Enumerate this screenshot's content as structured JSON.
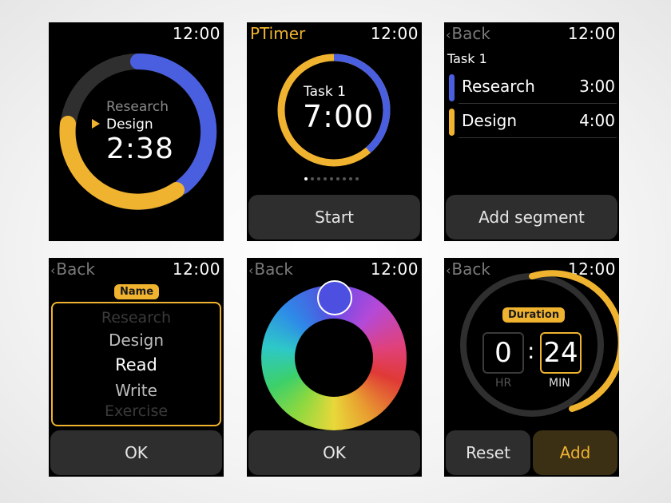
{
  "status_time": "12:00",
  "back_label": "Back",
  "colors": {
    "accent_yellow": "#f0b330",
    "accent_blue": "#4a5fe0",
    "button_bg": "#2e2e2e",
    "track_gray": "#2f2f2f"
  },
  "screen1": {
    "previous_segment": "Research",
    "current_segment": "Design",
    "remaining_time": "2:38",
    "ring_progress_fraction": 0.38
  },
  "screen2": {
    "app_title": "PTimer",
    "task_name": "Task 1",
    "total_time": "7:00",
    "page_count": 9,
    "active_page": 0,
    "start_label": "Start"
  },
  "screen3": {
    "task_name": "Task 1",
    "segments": [
      {
        "name": "Research",
        "duration": "3:00",
        "color": "#4a5fe0"
      },
      {
        "name": "Design",
        "duration": "4:00",
        "color": "#f0b330"
      }
    ],
    "add_segment_label": "Add segment"
  },
  "screen4": {
    "field_label": "Name",
    "options": [
      "Research",
      "Design",
      "Read",
      "Write",
      "Exercise"
    ],
    "selected": "Read",
    "ok_label": "OK"
  },
  "screen5": {
    "selected_color": "#4d4fe0",
    "ok_label": "OK"
  },
  "screen6": {
    "field_label": "Duration",
    "hours": "0",
    "separator": ":",
    "minutes": "24",
    "hours_label": "HR",
    "minutes_label": "MIN",
    "reset_label": "Reset",
    "add_label": "Add"
  }
}
